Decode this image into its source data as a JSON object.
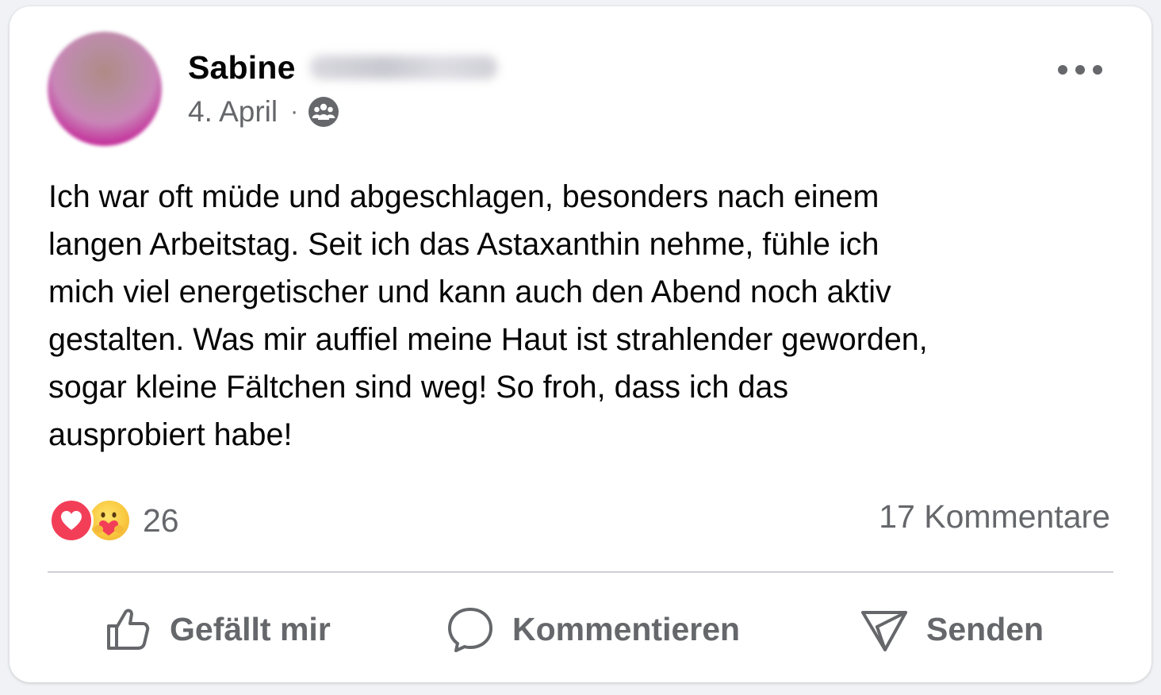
{
  "post": {
    "author_first_name": "Sabine",
    "date": "4. April",
    "separator": "·",
    "audience_icon": "group-icon",
    "text": "Ich war oft müde und abgeschlagen, besonders nach einem\nlangen Arbeitstag. Seit ich das Astaxanthin nehme, fühle ich\nmich viel energetischer und kann auch den Abend noch aktiv\ngestalten. Was mir auffiel meine Haut ist strahlender geworden,\nsogar kleine Fältchen sind weg! So froh, dass ich das\nausprobiert habe!"
  },
  "reactions": {
    "types": [
      "love",
      "care"
    ],
    "count": "26"
  },
  "comments": {
    "label": "17 Kommentare"
  },
  "actions": {
    "like_label": "Gefällt mir",
    "comment_label": "Kommentieren",
    "send_label": "Senden"
  },
  "colors": {
    "text_primary": "#050505",
    "text_secondary": "#65676b",
    "love": "#f33e58",
    "divider": "#ced0d4"
  }
}
